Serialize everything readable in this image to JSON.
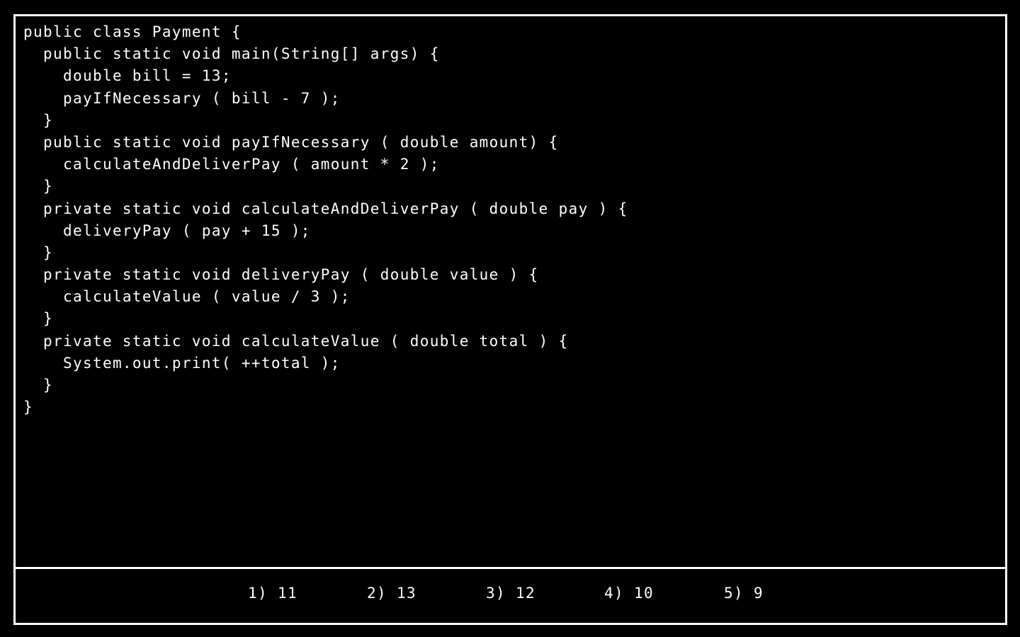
{
  "colors": {
    "background": "#000000",
    "foreground": "#ffffff",
    "border": "#ffffff"
  },
  "code": {
    "language": "Java",
    "lines": [
      "public class Payment {",
      "  public static void main(String[] args) {",
      "    double bill = 13;",
      "    payIfNecessary ( bill - 7 );",
      "  }",
      "  public static void payIfNecessary ( double amount) {",
      "    calculateAndDeliverPay ( amount * 2 );",
      "  }",
      "  private static void calculateAndDeliverPay ( double pay ) {",
      "    deliveryPay ( pay + 15 );",
      "  }",
      "  private static void deliveryPay ( double value ) {",
      "    calculateValue ( value / 3 );",
      "  }",
      "  private static void calculateValue ( double total ) {",
      "    System.out.print( ++total );",
      "  }",
      "}"
    ]
  },
  "answers": [
    {
      "label": "1) 11"
    },
    {
      "label": "2) 13"
    },
    {
      "label": "3) 12"
    },
    {
      "label": "4) 10"
    },
    {
      "label": "5) 9"
    }
  ]
}
